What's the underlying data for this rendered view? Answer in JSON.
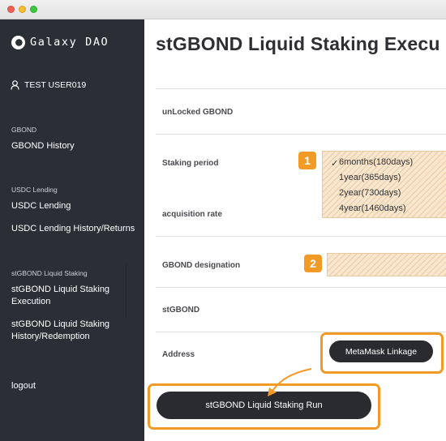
{
  "window": {
    "controls": [
      "close",
      "minimize",
      "maximize"
    ]
  },
  "sidebar": {
    "brand": "Galaxy DAO",
    "user": "TEST USER019",
    "sections": [
      {
        "heading": "GBOND",
        "items": [
          "GBOND History"
        ]
      },
      {
        "heading": "USDC Lending",
        "items": [
          "USDC Lending",
          "USDC Lending History/Returns"
        ]
      },
      {
        "heading": "stGBOND Liquid Staking",
        "items": [
          "stGBOND Liquid Staking Execution",
          "stGBOND Liquid Staking History/Redemption"
        ]
      }
    ],
    "active_item": "stGBOND Liquid Staking Execution",
    "logout": "logout"
  },
  "main": {
    "title": "stGBOND Liquid Staking Execu",
    "fields": {
      "unlocked": "unLocked GBOND",
      "period": "Staking period",
      "rate": "acquisition rate",
      "designation": "GBOND designation",
      "stgbond": "stGBOND",
      "address": "Address"
    },
    "staking_options": [
      "6months(180days)",
      "1year(365days)",
      "2year(730days)",
      "4year(1460days)"
    ],
    "selected_option": "6months(180days)",
    "selected_mark": "✓",
    "metamask_button": "MetaMask Linkage",
    "run_button": "stGBOND Liquid Staking Run"
  },
  "annotations": {
    "badge_1": "1",
    "badge_2": "2",
    "color": "#f29a26"
  },
  "colors": {
    "sidebar_bg": "#2b2e35",
    "highlight": "#f29a26",
    "button_dark": "#2a2b30"
  }
}
